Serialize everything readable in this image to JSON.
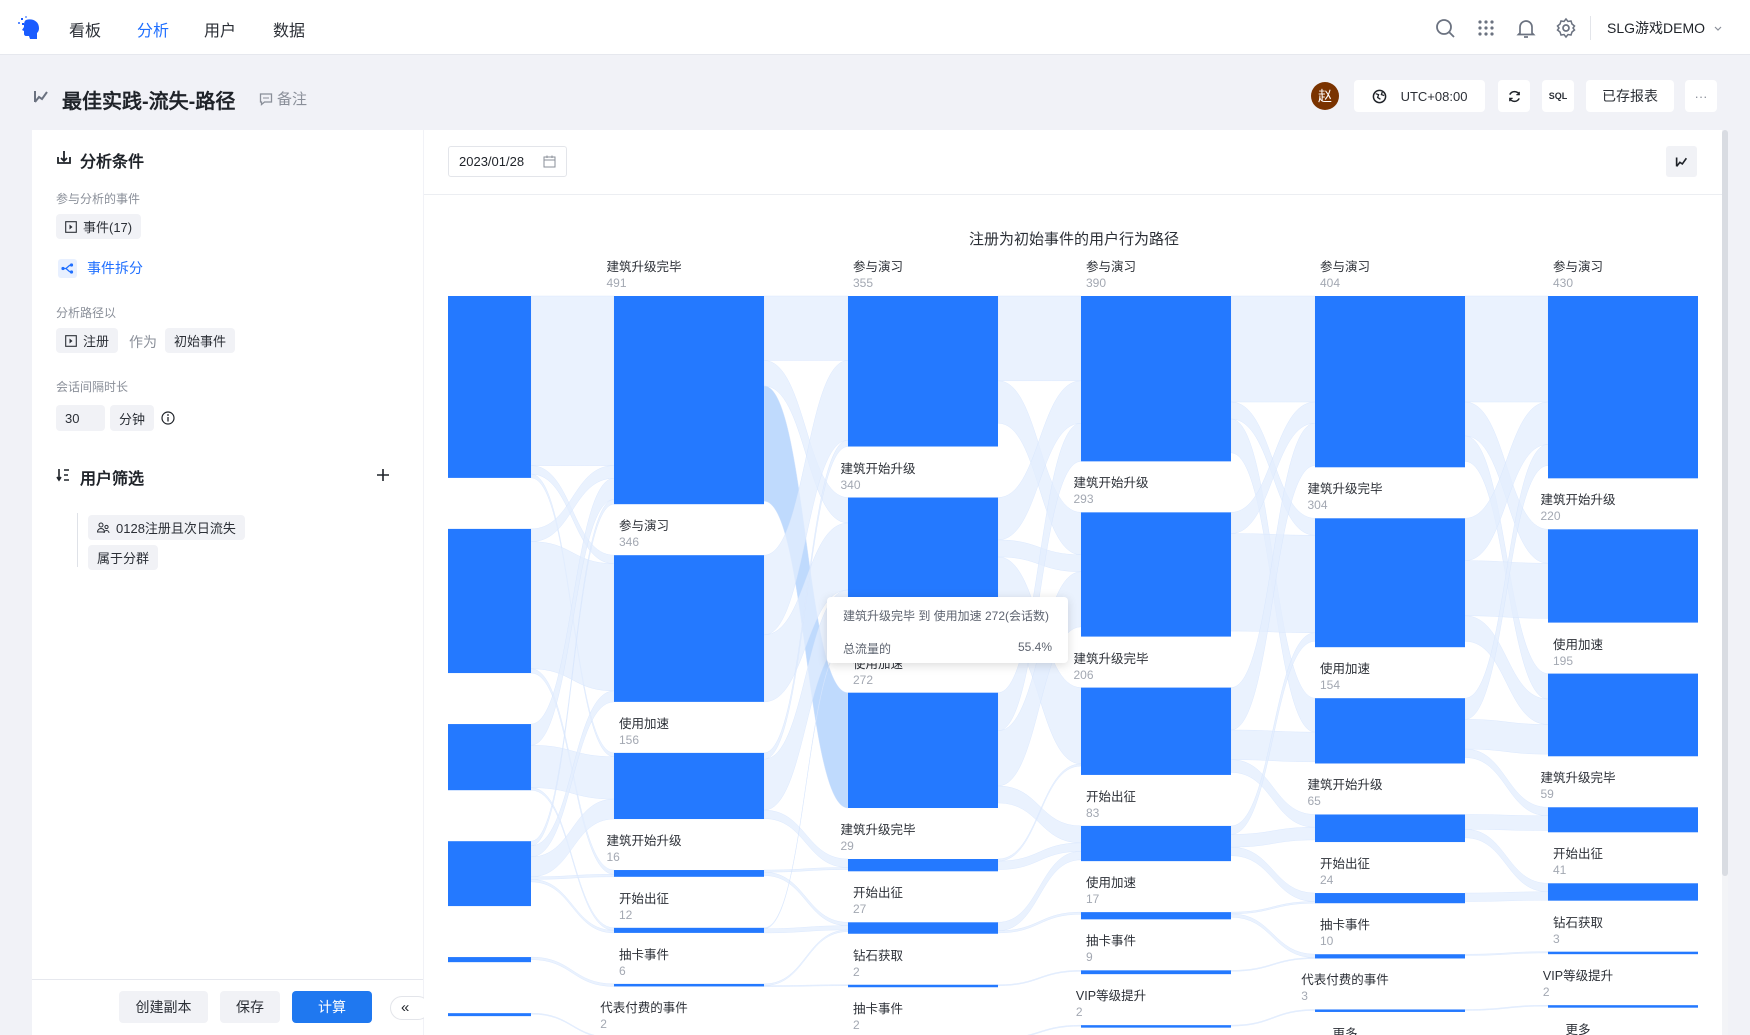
{
  "nav": {
    "items": [
      "看板",
      "分析",
      "用户",
      "数据"
    ],
    "active": "分析",
    "project": "SLG游戏DEMO"
  },
  "header": {
    "title": "最佳实践-流失-路径",
    "note": "备注",
    "avatar": "赵",
    "timezone": "UTC+08:00",
    "sql": "SQL",
    "saved_reports": "已存报表",
    "more": "···"
  },
  "left": {
    "conditions_title": "分析条件",
    "events_label": "参与分析的事件",
    "events_chip": "事件(17)",
    "split_label": "事件拆分",
    "path_label": "分析路径以",
    "path_event": "注册",
    "path_as": "作为",
    "path_role": "初始事件",
    "session_label": "会话间隔时长",
    "session_value": "30",
    "session_unit": "分钟",
    "filter_title": "用户筛选",
    "filter_segment": "0128注册且次日流失",
    "filter_op": "属于分群",
    "copy": "创建副本",
    "save": "保存",
    "compute": "计算",
    "collapse": "«"
  },
  "main": {
    "date": "2023/01/28"
  },
  "colors": {
    "node": "#2479ff",
    "link": "#e3eefe",
    "link_hl": "#bcd8fd",
    "accent": "#1f6fff"
  },
  "chart_data": {
    "type": "sankey",
    "title": "注册为初始事件的用户行为路径",
    "columns": [
      [
        {
          "name": "",
          "value": 429
        },
        {
          "name": "",
          "value": 340
        },
        {
          "name": "",
          "value": 156
        },
        {
          "name": "",
          "value": 153
        },
        {
          "name": "",
          "value": 12
        },
        {
          "name": "",
          "value": 7
        }
      ],
      [
        {
          "name": "建筑升级完毕",
          "value": 491
        },
        {
          "name": "参与演习",
          "value": 346
        },
        {
          "name": "使用加速",
          "value": 156
        },
        {
          "name": "建筑开始升级",
          "value": 16
        },
        {
          "name": "开始出征",
          "value": 12
        },
        {
          "name": "抽卡事件",
          "value": 6
        },
        {
          "name": "代表付费的事件",
          "value": 2
        }
      ],
      [
        {
          "name": "参与演习",
          "value": 355
        },
        {
          "name": "建筑开始升级",
          "value": 340
        },
        {
          "name": "使用加速",
          "value": 272
        },
        {
          "name": "建筑升级完毕",
          "value": 29
        },
        {
          "name": "开始出征",
          "value": 27
        },
        {
          "name": "钻石获取",
          "value": 2
        },
        {
          "name": "抽卡事件",
          "value": 2
        }
      ],
      [
        {
          "name": "参与演习",
          "value": 390
        },
        {
          "name": "建筑开始升级",
          "value": 293
        },
        {
          "name": "建筑升级完毕",
          "value": 206
        },
        {
          "name": "开始出征",
          "value": 83
        },
        {
          "name": "使用加速",
          "value": 17
        },
        {
          "name": "抽卡事件",
          "value": 9
        },
        {
          "name": "VIP等级提升",
          "value": 2
        }
      ],
      [
        {
          "name": "参与演习",
          "value": 404
        },
        {
          "name": "建筑升级完毕",
          "value": 304
        },
        {
          "name": "使用加速",
          "value": 154
        },
        {
          "name": "建筑开始升级",
          "value": 65
        },
        {
          "name": "开始出征",
          "value": 24
        },
        {
          "name": "抽卡事件",
          "value": 10
        },
        {
          "name": "代表付费的事件",
          "value": 3
        },
        {
          "name": "更多",
          "value": null
        }
      ],
      [
        {
          "name": "参与演习",
          "value": 430
        },
        {
          "name": "建筑开始升级",
          "value": 220
        },
        {
          "name": "使用加速",
          "value": 195
        },
        {
          "name": "建筑升级完毕",
          "value": 59
        },
        {
          "name": "开始出征",
          "value": 41
        },
        {
          "name": "钻石获取",
          "value": 3
        },
        {
          "name": "VIP等级提升",
          "value": 2
        },
        {
          "name": "更多",
          "value": null
        }
      ]
    ],
    "links": [
      [
        0,
        0,
        0,
        400
      ],
      [
        0,
        0,
        1,
        20
      ],
      [
        0,
        0,
        2,
        9
      ],
      [
        0,
        1,
        1,
        300
      ],
      [
        0,
        1,
        0,
        30
      ],
      [
        0,
        1,
        3,
        10
      ],
      [
        0,
        2,
        0,
        50
      ],
      [
        0,
        2,
        2,
        100
      ],
      [
        0,
        2,
        4,
        6
      ],
      [
        0,
        3,
        2,
        47
      ],
      [
        0,
        3,
        1,
        26
      ],
      [
        0,
        3,
        0,
        11
      ],
      [
        0,
        3,
        3,
        6
      ],
      [
        0,
        3,
        4,
        6
      ],
      [
        0,
        4,
        5,
        6
      ],
      [
        0,
        5,
        6,
        2
      ],
      [
        1,
        0,
        2,
        272
      ],
      [
        1,
        0,
        0,
        152
      ],
      [
        1,
        0,
        1,
        60
      ],
      [
        1,
        1,
        0,
        188
      ],
      [
        1,
        1,
        1,
        158
      ],
      [
        1,
        2,
        1,
        120
      ],
      [
        1,
        2,
        3,
        20
      ],
      [
        1,
        2,
        0,
        15
      ],
      [
        1,
        3,
        3,
        5
      ],
      [
        1,
        3,
        4,
        8
      ],
      [
        1,
        4,
        4,
        10
      ],
      [
        1,
        4,
        1,
        2
      ],
      [
        1,
        5,
        4,
        4
      ],
      [
        1,
        5,
        5,
        2
      ],
      [
        1,
        6,
        6,
        2
      ],
      [
        2,
        0,
        0,
        200
      ],
      [
        2,
        0,
        1,
        100
      ],
      [
        2,
        1,
        2,
        180
      ],
      [
        2,
        1,
        0,
        100
      ],
      [
        2,
        1,
        1,
        40
      ],
      [
        2,
        2,
        0,
        90
      ],
      [
        2,
        2,
        1,
        130
      ],
      [
        2,
        2,
        3,
        40
      ],
      [
        2,
        3,
        3,
        20
      ],
      [
        2,
        3,
        2,
        5
      ],
      [
        2,
        4,
        3,
        20
      ],
      [
        2,
        4,
        4,
        5
      ],
      [
        2,
        5,
        5,
        2
      ],
      [
        2,
        6,
        6,
        2
      ],
      [
        3,
        0,
        0,
        250
      ],
      [
        3,
        0,
        2,
        80
      ],
      [
        3,
        0,
        1,
        40
      ],
      [
        3,
        1,
        1,
        230
      ],
      [
        3,
        1,
        0,
        50
      ],
      [
        3,
        2,
        0,
        100
      ],
      [
        3,
        2,
        2,
        70
      ],
      [
        3,
        2,
        3,
        30
      ],
      [
        3,
        3,
        3,
        30
      ],
      [
        3,
        3,
        4,
        20
      ],
      [
        3,
        3,
        1,
        20
      ],
      [
        3,
        4,
        4,
        4
      ],
      [
        3,
        4,
        5,
        8
      ],
      [
        3,
        5,
        5,
        2
      ],
      [
        3,
        6,
        6,
        2
      ],
      [
        4,
        0,
        0,
        250
      ],
      [
        4,
        0,
        1,
        80
      ],
      [
        4,
        0,
        2,
        60
      ],
      [
        4,
        1,
        1,
        130
      ],
      [
        4,
        1,
        0,
        100
      ],
      [
        4,
        1,
        2,
        60
      ],
      [
        4,
        2,
        2,
        70
      ],
      [
        4,
        2,
        0,
        50
      ],
      [
        4,
        2,
        3,
        20
      ],
      [
        4,
        3,
        3,
        35
      ],
      [
        4,
        3,
        4,
        20
      ],
      [
        4,
        4,
        4,
        20
      ],
      [
        4,
        5,
        5,
        3
      ],
      [
        4,
        6,
        6,
        2
      ]
    ],
    "highlight_link": [
      1,
      0,
      2
    ],
    "tooltip": {
      "title": "建筑升级完毕 到 使用加速 272(会话数)",
      "label": "总流量的",
      "value": "55.4%"
    }
  }
}
